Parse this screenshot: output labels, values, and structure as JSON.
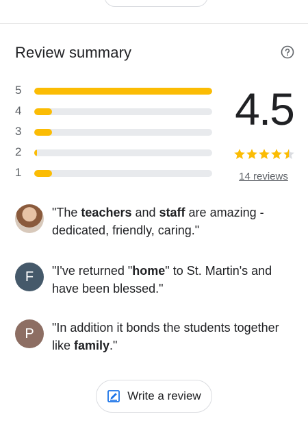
{
  "summary": {
    "title": "Review summary",
    "rating": "4.5",
    "stars": 4.5,
    "review_count_label": "14 reviews",
    "help_icon": "help-circle-icon"
  },
  "distribution": [
    {
      "label": "5",
      "fraction": 1.0
    },
    {
      "label": "4",
      "fraction": 0.1
    },
    {
      "label": "3",
      "fraction": 0.1
    },
    {
      "label": "2",
      "fraction": 0.01
    },
    {
      "label": "1",
      "fraction": 0.1
    }
  ],
  "snippets": [
    {
      "avatar_type": "photo",
      "avatar_letter": "",
      "parts": [
        {
          "t": "\"The ",
          "b": false
        },
        {
          "t": "teachers",
          "b": true
        },
        {
          "t": " and ",
          "b": false
        },
        {
          "t": "staff",
          "b": true
        },
        {
          "t": " are amazing - dedicated, friendly, caring.\"",
          "b": false
        }
      ]
    },
    {
      "avatar_type": "letter",
      "avatar_letter": "F",
      "avatar_color": "#45596a",
      "parts": [
        {
          "t": "\"I've returned \"",
          "b": false
        },
        {
          "t": "home",
          "b": true
        },
        {
          "t": "\" to St. Martin's and have been blessed.\"",
          "b": false
        }
      ]
    },
    {
      "avatar_type": "letter",
      "avatar_letter": "P",
      "avatar_color": "#8d6e63",
      "parts": [
        {
          "t": "\"In addition it bonds the students together like ",
          "b": false
        },
        {
          "t": "family",
          "b": true
        },
        {
          "t": ".\"",
          "b": false
        }
      ]
    }
  ],
  "write_review": {
    "label": "Write a review",
    "icon": "edit-icon"
  },
  "colors": {
    "star": "#fbbc04",
    "bar_track": "#e8eaed",
    "accent_blue": "#1a73e8"
  }
}
